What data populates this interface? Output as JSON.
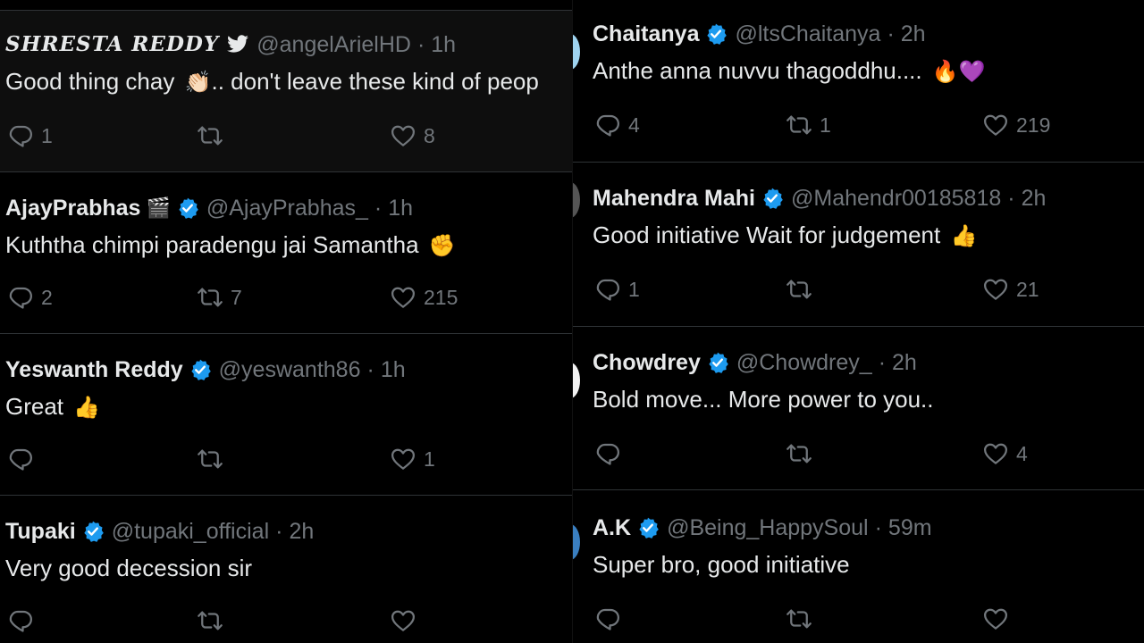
{
  "left_tweets": [
    {
      "name": "SHRESTA REDDY",
      "handle": "@angelArielHD",
      "time": "1h",
      "text": "Good thing chay",
      "text_emoji": "👏🏻",
      "text_rest": ".. don't leave these kind of peop",
      "replies": "1",
      "retweets": "",
      "likes": "8"
    },
    {
      "name": "AjayPrabhas",
      "name_emoji": "🎬",
      "handle": "@AjayPrabhas_",
      "time": "1h",
      "text": "Kuththa chimpi paradengu jai Samantha",
      "text_emoji": "✊",
      "replies": "2",
      "retweets": "7",
      "likes": "215"
    },
    {
      "name": "Yeswanth Reddy",
      "handle": "@yeswanth86",
      "time": "1h",
      "text": "Great",
      "text_emoji": "👍",
      "replies": "",
      "retweets": "",
      "likes": "1"
    },
    {
      "name": "Tupaki",
      "handle": "@tupaki_official",
      "time": "2h",
      "text": "Very good decession sir",
      "replies": "",
      "retweets": "",
      "likes": ""
    }
  ],
  "right_tweets": [
    {
      "name": "Chaitanya",
      "handle": "@ltsChaitanya",
      "time": "2h",
      "text": "Anthe anna nuvvu thagoddhu....",
      "text_emoji": "🔥💜",
      "replies": "4",
      "retweets": "1",
      "likes": "219"
    },
    {
      "name": "Mahendra Mahi",
      "handle": "@Mahendr00185818",
      "time": "2h",
      "text": "Good initiative Wait for judgement",
      "text_emoji": "👍",
      "replies": "1",
      "retweets": "",
      "likes": "21"
    },
    {
      "name": "Chowdrey",
      "handle": "@Chowdrey_",
      "time": "2h",
      "text": "Bold move... More power to you..",
      "replies": "",
      "retweets": "",
      "likes": "4"
    },
    {
      "name": "A.K",
      "handle": "@Being_HappySoul",
      "time": "59m",
      "text": "Super bro, good initiative",
      "replies": "",
      "retweets": "",
      "likes": ""
    }
  ],
  "separator": "·",
  "colors": {
    "background": "#000000",
    "text": "#e7e9ea",
    "muted": "#71767b",
    "verified": "#1d9bf0",
    "divider": "#2f3336"
  },
  "icons": [
    "reply-icon",
    "retweet-icon",
    "like-icon",
    "verified-badge-icon",
    "twitter-bird-icon"
  ]
}
